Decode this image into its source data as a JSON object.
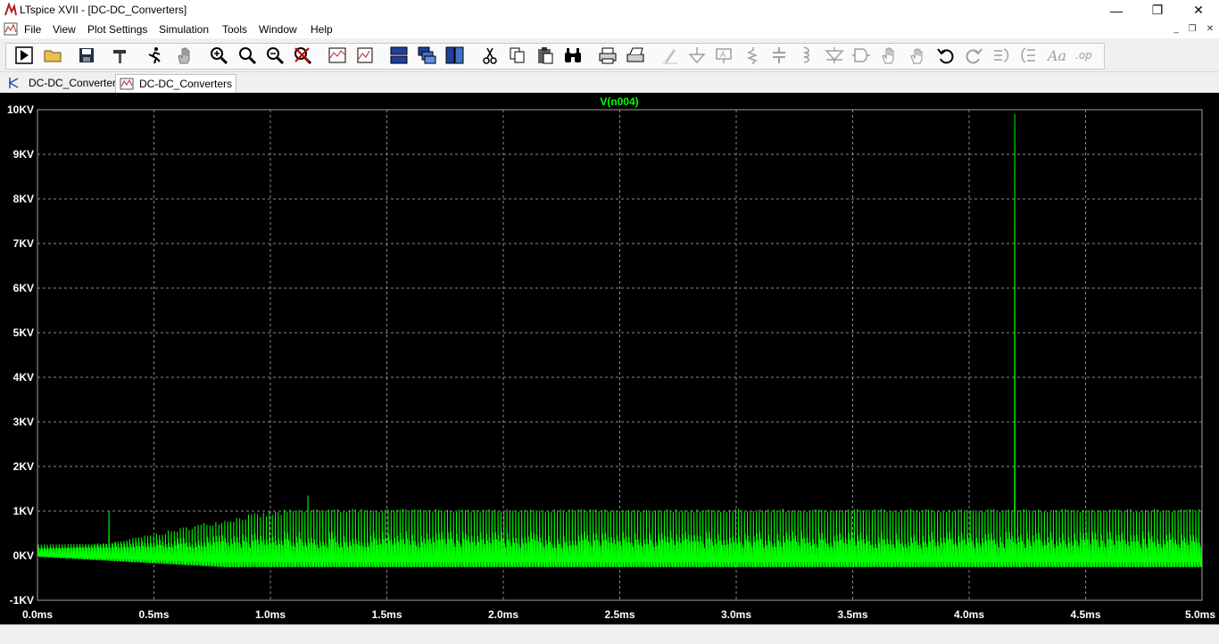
{
  "window": {
    "title": "LTspice XVII - [DC-DC_Converters]"
  },
  "menu": [
    "File",
    "View",
    "Plot Settings",
    "Simulation",
    "Tools",
    "Window",
    "Help"
  ],
  "tabs": [
    {
      "label": "DC-DC_Converters",
      "icon": "schematic-icon",
      "active": false
    },
    {
      "label": "DC-DC_Converters",
      "icon": "waveform-icon",
      "active": true
    }
  ],
  "colors": {
    "plot_bg": "#000000",
    "trace": "#00ff00",
    "grid": "#8a8a8a",
    "axis_text": "#ffffff"
  },
  "chart_data": {
    "type": "line",
    "title": "V(n004)",
    "series": [
      {
        "name": "V(n004)",
        "color": "#00ff00"
      }
    ],
    "xlim": [
      0.0,
      5.0
    ],
    "ylim": [
      -1,
      10
    ],
    "x_ticks": [
      "0.0ms",
      "0.5ms",
      "1.0ms",
      "1.5ms",
      "2.0ms",
      "2.5ms",
      "3.0ms",
      "3.5ms",
      "4.0ms",
      "4.5ms",
      "5.0ms"
    ],
    "y_ticks": [
      "-1KV",
      "0KV",
      "1KV",
      "2KV",
      "3KV",
      "4KV",
      "5KV",
      "6KV",
      "7KV",
      "8KV",
      "9KV",
      "10KV"
    ],
    "grid": true,
    "description_values": {
      "steady_peak_kv": 1.05,
      "steady_min_kv": -0.25,
      "spike_time_ms": 4.2,
      "spike_peak_kv": 9.9,
      "early_spike_time_ms": 1.16,
      "early_spike_peak_kv": 1.35,
      "ramp_end_ms": 1.2
    }
  }
}
